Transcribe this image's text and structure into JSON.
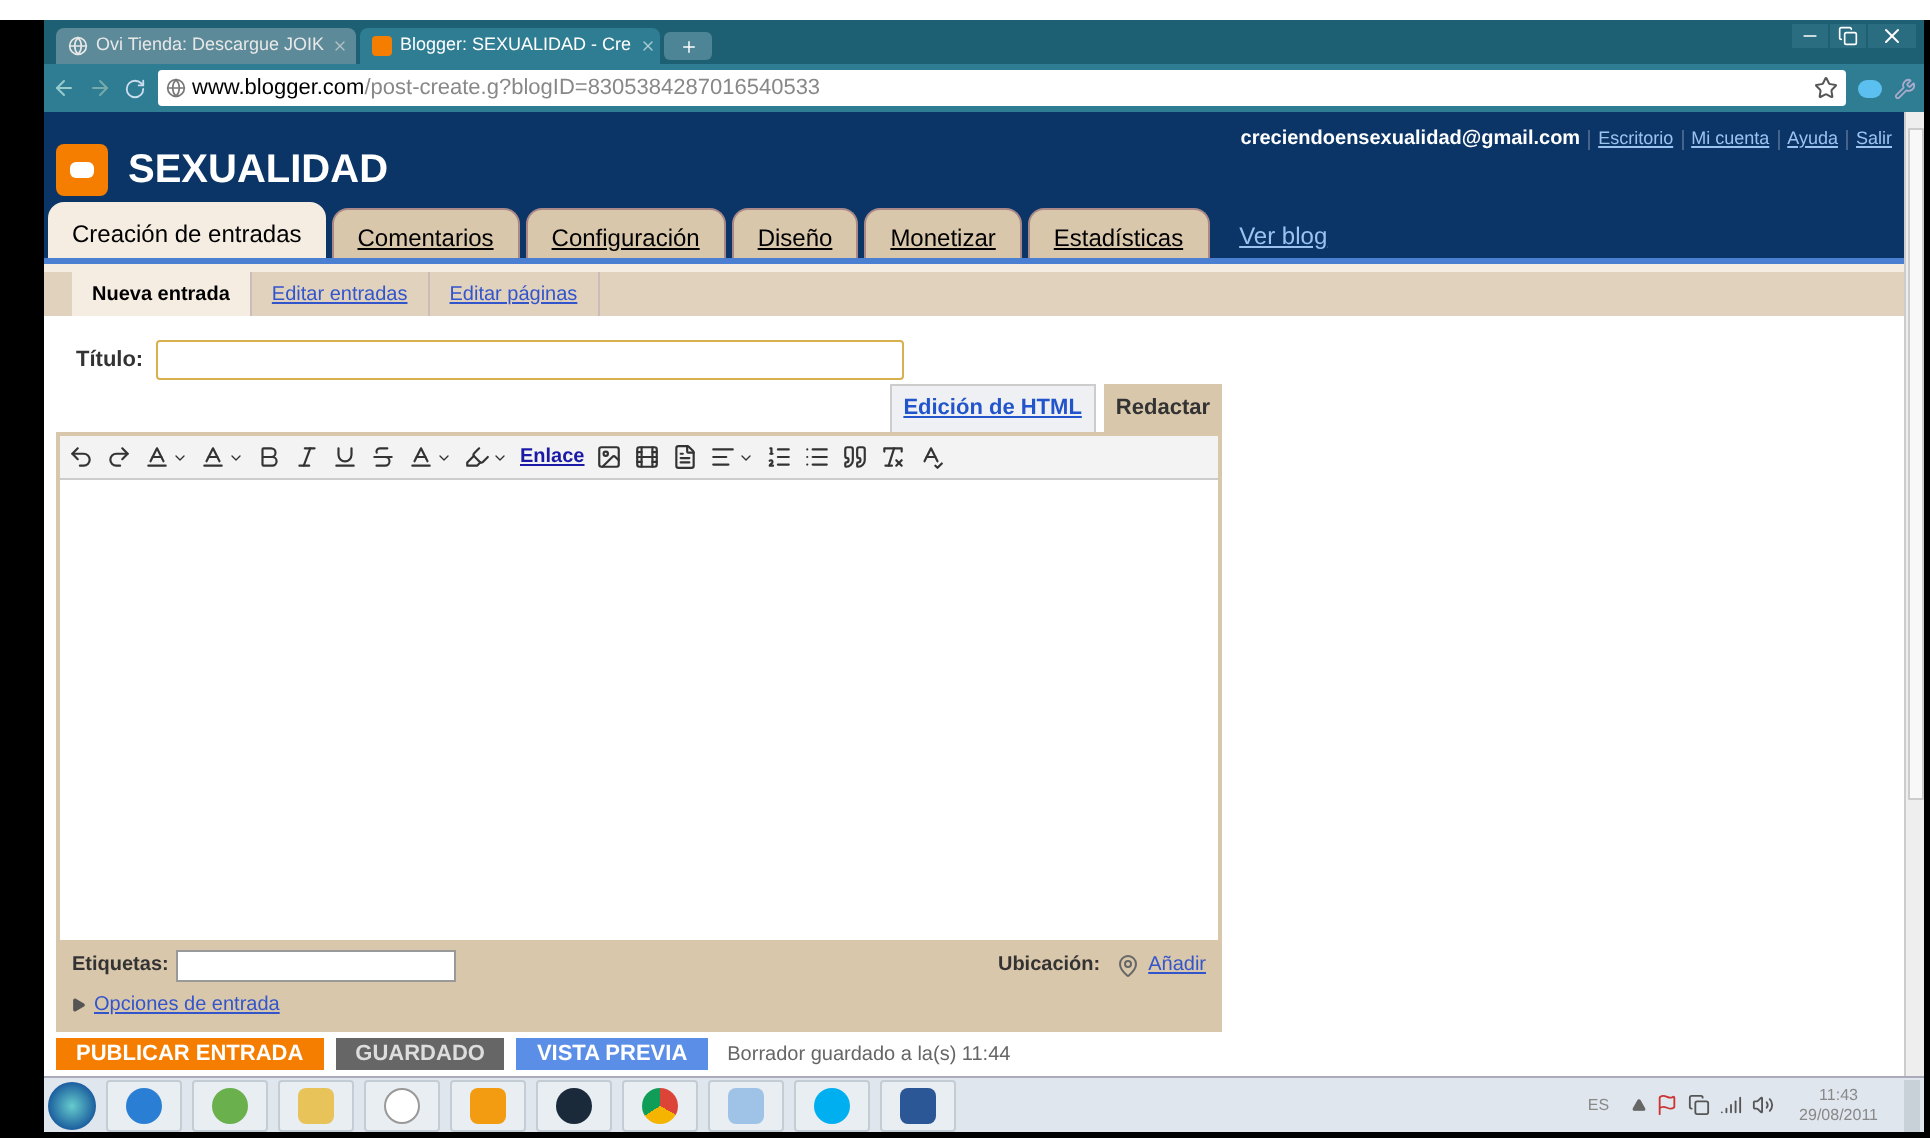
{
  "browser": {
    "tabs": [
      {
        "title": "Ovi Tienda: Descargue JOIK",
        "selected": false
      },
      {
        "title": "Blogger: SEXUALIDAD - Cre",
        "selected": true
      }
    ],
    "address": {
      "domain": "www.blogger.com",
      "path": "/post-create.g?blogID=8305384287016540533"
    }
  },
  "blog": {
    "title": "SEXUALIDAD",
    "email": "creciendoensexualidad@gmail.com",
    "links": [
      "Escritorio",
      "Mi cuenta",
      "Ayuda",
      "Salir"
    ]
  },
  "main_tabs": [
    {
      "label": "Creación de entradas",
      "selected": true
    },
    {
      "label": "Comentarios",
      "selected": false
    },
    {
      "label": "Configuración",
      "selected": false
    },
    {
      "label": "Diseño",
      "selected": false
    },
    {
      "label": "Monetizar",
      "selected": false
    },
    {
      "label": "Estadísticas",
      "selected": false
    }
  ],
  "view_blog": "Ver blog",
  "sub_tabs": [
    {
      "label": "Nueva entrada",
      "selected": true
    },
    {
      "label": "Editar entradas",
      "selected": false
    },
    {
      "label": "Editar páginas",
      "selected": false
    }
  ],
  "editor": {
    "title_label": "Título:",
    "mode_tabs": [
      {
        "label": "Edición de HTML",
        "selected": false
      },
      {
        "label": "Redactar",
        "selected": true
      }
    ],
    "link_label": "Enlace",
    "tags_label": "Etiquetas:",
    "location_label": "Ubicación:",
    "add_link": "Añadir",
    "options_link": "Opciones de entrada"
  },
  "actions": [
    {
      "label": "PUBLICAR ENTRADA",
      "kind": "publish"
    },
    {
      "label": "GUARDADO",
      "kind": "saved"
    },
    {
      "label": "VISTA PREVIA",
      "kind": "preview"
    }
  ],
  "draft_status": "Borrador guardado a la(s) 11:44",
  "taskbar": {
    "language": "ES",
    "time": "11:43",
    "date": "29/08/2011"
  }
}
